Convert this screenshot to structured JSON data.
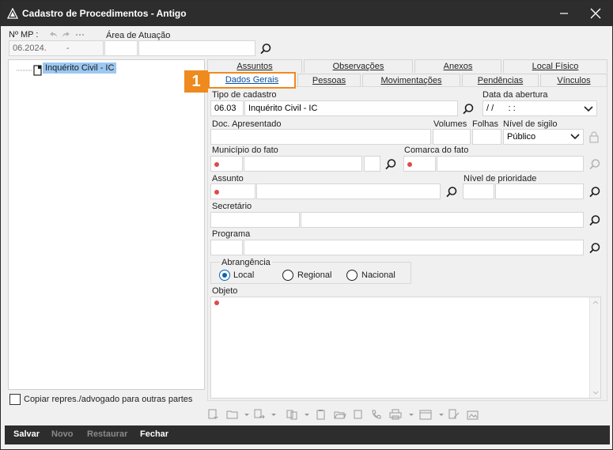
{
  "window": {
    "title": "Cadastro de Procedimentos - Antigo"
  },
  "header": {
    "mp_label": "Nº MP :",
    "mp_value": "06.2024.",
    "mp_dash": "-",
    "area_label": "Área de Atuação"
  },
  "tree": {
    "selected_item": "Inquérito Civil - IC"
  },
  "tabs_row1": [
    {
      "label": "Assuntos"
    },
    {
      "label": "Observações"
    },
    {
      "label": "Anexos"
    },
    {
      "label": "Local Físico"
    }
  ],
  "tabs_row2": [
    {
      "label": "Dados Gerais"
    },
    {
      "label": "Pessoas"
    },
    {
      "label": "Movimentações"
    },
    {
      "label": "Pendências"
    },
    {
      "label": "Vínculos"
    }
  ],
  "step_badge": "1",
  "form": {
    "tipo_cadastro_label": "Tipo de cadastro",
    "tipo_cadastro_code": "06.03",
    "tipo_cadastro_value": "Inquérito Civil - IC",
    "data_abertura_label": "Data da abertura",
    "data_abertura_value": "/ /      : :",
    "doc_apresentado_label": "Doc. Apresentado",
    "volumes_label": "Volumes",
    "folhas_label": "Folhas",
    "nivel_sigilo_label": "Nível de sigilo",
    "nivel_sigilo_value": "Público",
    "municipio_label": "Município do fato",
    "comarca_label": "Comarca do fato",
    "assunto_label": "Assunto",
    "nivel_prioridade_label": "Nível de prioridade",
    "secretario_label": "Secretário",
    "programa_label": "Programa",
    "abrangencia_label": "Abrangência",
    "abrangencia_options": [
      "Local",
      "Regional",
      "Nacional"
    ],
    "objeto_label": "Objeto"
  },
  "copy_checkbox_label": "Copiar repres./advogado para outras partes",
  "footer": {
    "salvar": "Salvar",
    "novo": "Novo",
    "restaurar": "Restaurar",
    "fechar": "Fechar"
  },
  "colors": {
    "titlebar": "#2d2d2d",
    "accent_orange": "#ef8a1e",
    "selection_blue": "#9cc8f2",
    "required_dot": "#e04a4a",
    "radio_blue": "#0a64b4"
  }
}
